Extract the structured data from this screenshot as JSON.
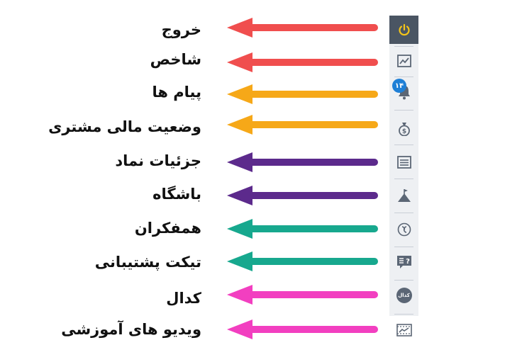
{
  "items": [
    {
      "label": "خروج",
      "color": "#f04e4e",
      "icon": "power-icon"
    },
    {
      "label": "شاخص",
      "color": "#f04e4e",
      "icon": "chart-line-icon"
    },
    {
      "label": "پیام ها",
      "color": "#f6a818",
      "icon": "bell-icon",
      "badge": "۱۴"
    },
    {
      "label": "وضعیت مالی مشتری",
      "color": "#f6a818",
      "icon": "money-bag-icon"
    },
    {
      "label": "جزئیات نماد",
      "color": "#5c2a8c",
      "icon": "list-icon"
    },
    {
      "label": "باشگاه",
      "color": "#5c2a8c",
      "icon": "mountain-flag-icon"
    },
    {
      "label": "همفکران",
      "color": "#17a88e",
      "icon": "link-circle-icon"
    },
    {
      "label": "تیکت پشتیبانی",
      "color": "#17a88e",
      "icon": "ticket-question-icon"
    },
    {
      "label": "کدال",
      "color": "#f23fc0",
      "icon": "kandal-icon",
      "icon_text": "کدال"
    },
    {
      "label": "ویدیو های آموزشی",
      "color": "#f23fc0",
      "icon": "video-icon"
    }
  ]
}
